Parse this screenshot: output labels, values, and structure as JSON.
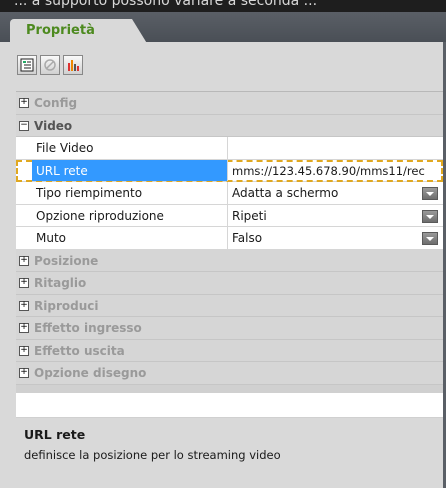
{
  "window_top_text": "... a supporto possono variare a seconda ...",
  "tab": {
    "label": "Proprietà"
  },
  "toolbar": {
    "icons": [
      "categorized-view-icon",
      "alphabetical-view-icon",
      "chart-icon"
    ]
  },
  "grid": {
    "categories_before": [
      {
        "label": "Config",
        "expanded": false
      }
    ],
    "open_category": {
      "label": "Video",
      "expanded": true
    },
    "properties": [
      {
        "name": "File Video",
        "value": "",
        "dropdown": false
      },
      {
        "name": "URL rete",
        "value": "mms://123.45.678.90/mms11/rec",
        "dropdown": false,
        "selected": true
      },
      {
        "name": "Tipo riempimento",
        "value": "Adatta a schermo",
        "dropdown": true
      },
      {
        "name": "Opzione riproduzione",
        "value": "Ripeti",
        "dropdown": true
      },
      {
        "name": "Muto",
        "value": "Falso",
        "dropdown": true
      }
    ],
    "categories_after": [
      {
        "label": "Posizione",
        "expanded": false
      },
      {
        "label": "Ritaglio",
        "expanded": false
      },
      {
        "label": "Riproduci",
        "expanded": false
      },
      {
        "label": "Effetto ingresso",
        "expanded": false
      },
      {
        "label": "Effetto uscita",
        "expanded": false
      },
      {
        "label": "Opzione disegno",
        "expanded": false
      }
    ]
  },
  "help": {
    "title": "URL rete",
    "description": "definisce la posizione per lo streaming video"
  },
  "colors": {
    "accent_tab": "#4d8a1f",
    "selection": "#3399ff",
    "focus_border": "#e0a820"
  }
}
